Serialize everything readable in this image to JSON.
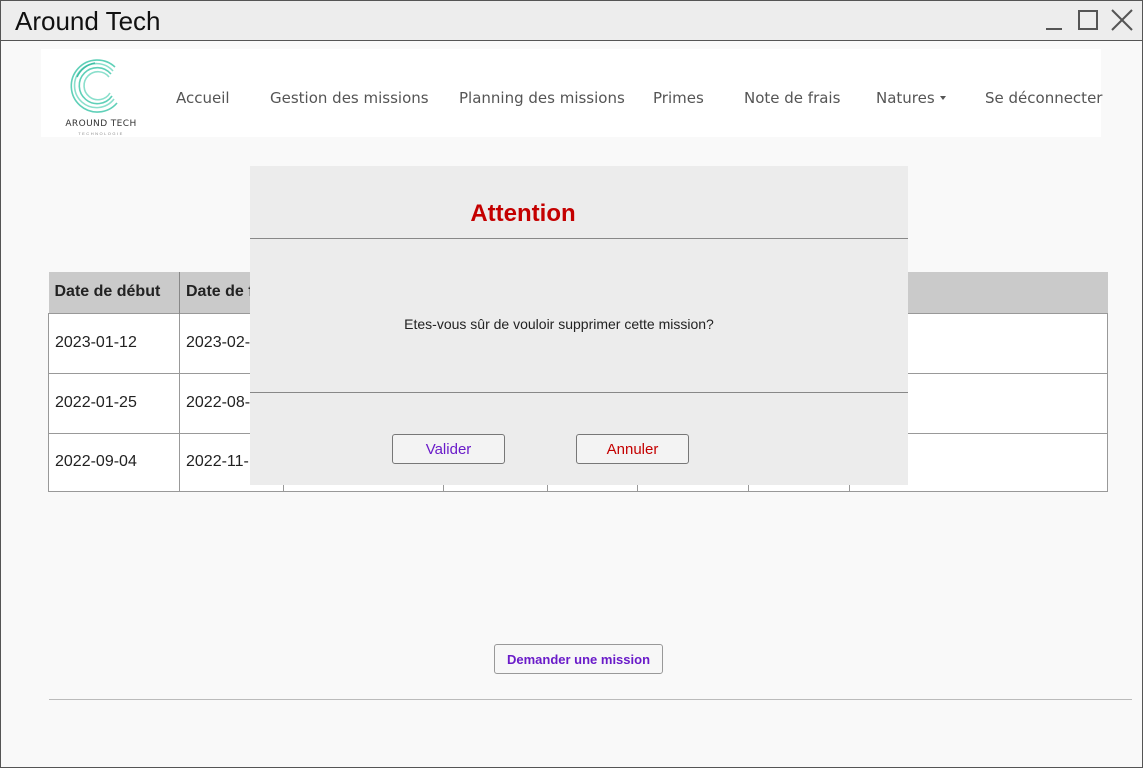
{
  "window": {
    "title": "Around Tech"
  },
  "logo": {
    "name": "AROUND TECH",
    "sub": "TECHNOLOGIE"
  },
  "nav": {
    "items": [
      "Accueil",
      "Gestion des missions",
      "Planning des missions",
      "Primes",
      "Note de frais",
      "Natures",
      "Se déconnecter"
    ]
  },
  "table": {
    "headers": [
      "Date de début",
      "Date de f"
    ],
    "rows": [
      [
        "2023-01-12",
        "2023-02-"
      ],
      [
        "2022-01-25",
        "2022-08-"
      ],
      [
        "2022-09-04",
        "2022-11-"
      ]
    ]
  },
  "modal": {
    "title": "Attention",
    "message": "Etes-vous sûr de vouloir supprimer cette mission?",
    "confirm_label": "Valider",
    "cancel_label": "Annuler"
  },
  "actions": {
    "request_label": "Demander une mission"
  },
  "colors": {
    "accent_purple": "#6a1bc9",
    "danger_red": "#c40000",
    "logo_teal": "#5fd0b8"
  }
}
